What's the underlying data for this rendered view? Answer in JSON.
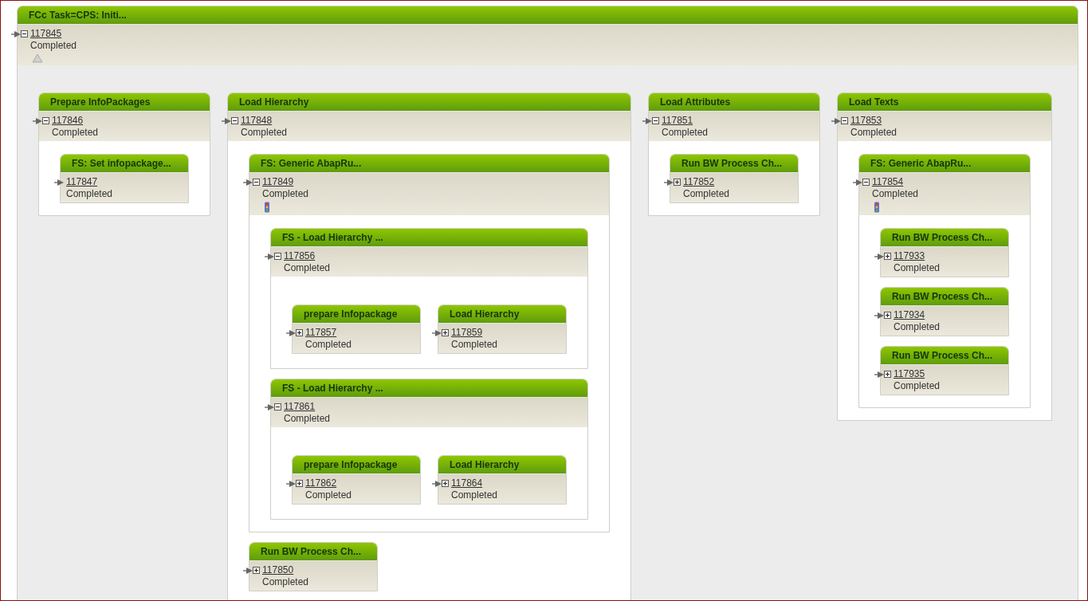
{
  "root": {
    "kind": "task",
    "title": "FCc Task=CPS: Initi...",
    "id": "117845",
    "status": "Completed",
    "expanded": true,
    "children": [
      {
        "kind": "step",
        "title": "Prepare InfoPackages",
        "id": "117846",
        "status": "Completed",
        "expanded": true,
        "children": [
          {
            "title": "FS: Set infopackage...",
            "id": "117847",
            "status": "Completed"
          }
        ]
      },
      {
        "kind": "step",
        "title": "Load Hierarchy",
        "id": "117848",
        "status": "Completed",
        "expanded": true,
        "children": [
          {
            "kind": "abap-step",
            "title": "FS: Generic AbapRu...",
            "id": "117849",
            "status": "Completed",
            "expanded": true,
            "children": [
              {
                "kind": "hierarchy-load",
                "title": "FS - Load Hierarchy ...",
                "id": "117856",
                "status": "Completed",
                "expanded": true,
                "children": [
                  {
                    "title": "prepare Infopackage",
                    "id": "117857",
                    "status": "Completed",
                    "expanded": false
                  },
                  {
                    "title": "Load Hierarchy",
                    "id": "117859",
                    "status": "Completed",
                    "expanded": false
                  }
                ]
              },
              {
                "kind": "hierarchy-load",
                "title": "FS - Load Hierarchy ...",
                "id": "117861",
                "status": "Completed",
                "expanded": true,
                "children": [
                  {
                    "title": "prepare Infopackage",
                    "id": "117862",
                    "status": "Completed",
                    "expanded": false
                  },
                  {
                    "title": "Load Hierarchy",
                    "id": "117864",
                    "status": "Completed",
                    "expanded": false
                  }
                ]
              }
            ]
          },
          {
            "title": "Run BW Process Ch...",
            "id": "117850",
            "status": "Completed",
            "expanded": false
          }
        ]
      },
      {
        "kind": "step",
        "title": "Load Attributes",
        "id": "117851",
        "status": "Completed",
        "expanded": true,
        "children": [
          {
            "title": "Run BW Process Ch...",
            "id": "117852",
            "status": "Completed",
            "expanded": false
          }
        ]
      },
      {
        "kind": "step",
        "title": "Load Texts",
        "id": "117853",
        "status": "Completed",
        "expanded": true,
        "children": [
          {
            "kind": "abap-step",
            "title": "FS: Generic AbapRu...",
            "id": "117854",
            "status": "Completed",
            "expanded": true,
            "children": [
              {
                "title": "Run BW Process Ch...",
                "id": "117933",
                "status": "Completed",
                "expanded": false
              },
              {
                "title": "Run BW Process Ch...",
                "id": "117934",
                "status": "Completed",
                "expanded": false
              },
              {
                "title": "Run BW Process Ch...",
                "id": "117935",
                "status": "Completed",
                "expanded": false
              }
            ]
          }
        ]
      }
    ]
  }
}
